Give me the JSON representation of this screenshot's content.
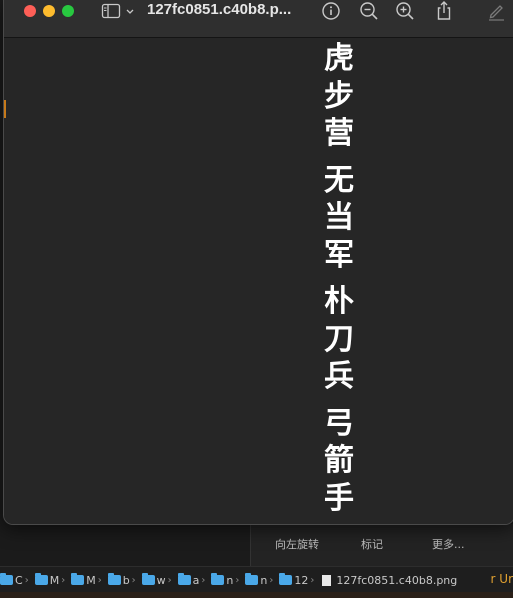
{
  "window": {
    "title": "127fc0851.c40b8.p..."
  },
  "toolbar": {
    "icons": [
      "sidebar-toggle-icon",
      "chevron-down-icon",
      "info-icon",
      "zoom-out-icon",
      "zoom-in-icon",
      "share-icon",
      "markup-pen-icon"
    ]
  },
  "image_content": {
    "groups": [
      [
        "虎",
        "步",
        "营"
      ],
      [
        "无",
        "当",
        "军"
      ],
      [
        "朴",
        "刀",
        "兵"
      ],
      [
        "弓",
        "箭",
        "手"
      ]
    ]
  },
  "background_app": {
    "toolbar_labels": [
      "向左旋转",
      "标记",
      "更多..."
    ],
    "path_segments": [
      "C",
      "M",
      "M",
      "b",
      "w",
      "a",
      "n",
      "n",
      "12"
    ],
    "file_name": "127fc0851.c40b8.png",
    "right_text": "r Ur"
  },
  "colors": {
    "close": "#fe5f57",
    "minimize": "#febc2e",
    "zoom": "#28c840",
    "folder": "#4aa8e8",
    "accent": "#e0a030"
  }
}
